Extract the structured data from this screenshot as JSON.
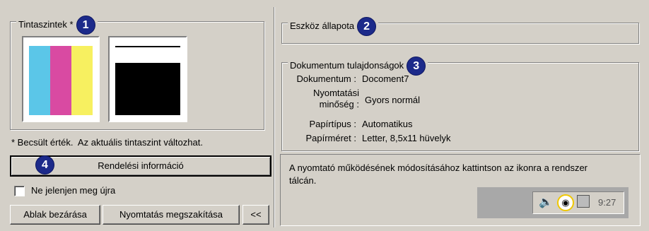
{
  "ink_panel": {
    "legend": "Tintaszintek *",
    "badge": "1",
    "color_tank": {
      "cyan_level": 1.0,
      "magenta_level": 1.0,
      "yellow_level": 1.0,
      "colors": [
        "#5bc6e8",
        "#d94aa2",
        "#f7f060"
      ]
    },
    "black_tank": {
      "level": 0.75,
      "color": "#000000"
    },
    "estimate_note": "* Becsült érték.  Az aktuális tintaszint változhat."
  },
  "order_button": {
    "badge": "4",
    "label": "Rendelési információ"
  },
  "dont_show_again": {
    "label": "Ne jelenjen meg újra",
    "checked": false
  },
  "buttons": {
    "close": "Ablak bezárása",
    "cancel_print": "Nyomtatás megszakítása",
    "collapse": "<<"
  },
  "device_status": {
    "legend": "Eszköz állapota",
    "badge": "2"
  },
  "doc_props": {
    "legend": "Dokumentum tulajdonságok",
    "badge": "3",
    "rows": [
      {
        "label": "Dokumentum :",
        "value": "Docoment7"
      },
      {
        "label": "Nyomtatási minőség :",
        "value": "Gyors normál"
      },
      {
        "label": "Papírtípus :",
        "value": "Automatikus"
      },
      {
        "label": "Papírméret :",
        "value": "Letter, 8,5x11 hüvelyk"
      }
    ]
  },
  "info": {
    "message": "A nyomtató működésének módosításához kattintson az ikonra a rendszer tálcán.",
    "tray_time": "9:27"
  }
}
